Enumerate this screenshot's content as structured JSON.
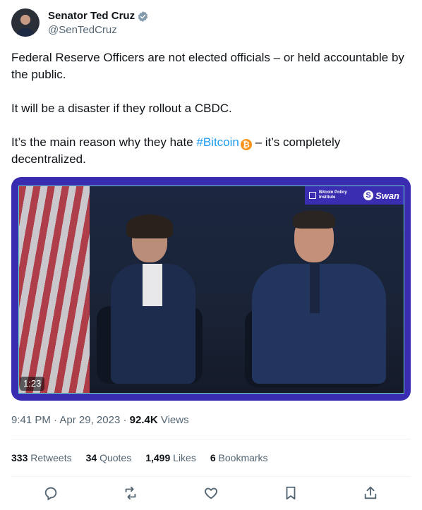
{
  "author": {
    "name": "Senator Ted Cruz",
    "handle": "@SenTedCruz",
    "verified_icon": "verified-badge-icon"
  },
  "tweet": {
    "line1": "Federal Reserve Officers are not elected officials – or held accountable by the public.",
    "line2": "It will be a disaster if they rollout a CBDC.",
    "line3_before": "It’s the main reason why they hate ",
    "hashtag": "#Bitcoin",
    "bitcoin_emoji": "₿",
    "line3_after": " – it’s completely decentralized."
  },
  "media": {
    "duration": "1:23",
    "overlay_logo_1": "Bitcoin Policy Institute",
    "overlay_logo_2": "Swan",
    "overlay_logo_2_icon": "S"
  },
  "meta": {
    "time": "9:41 PM",
    "separator": "·",
    "date": "Apr 29, 2023",
    "views_count": "92.4K",
    "views_label": "Views"
  },
  "stats": {
    "retweets_count": "333",
    "retweets_label": "Retweets",
    "quotes_count": "34",
    "quotes_label": "Quotes",
    "likes_count": "1,499",
    "likes_label": "Likes",
    "bookmarks_count": "6",
    "bookmarks_label": "Bookmarks"
  },
  "colors": {
    "accent": "#1d9bf0",
    "media_frame": "#3a2cb0",
    "bitcoin": "#f7931a"
  }
}
